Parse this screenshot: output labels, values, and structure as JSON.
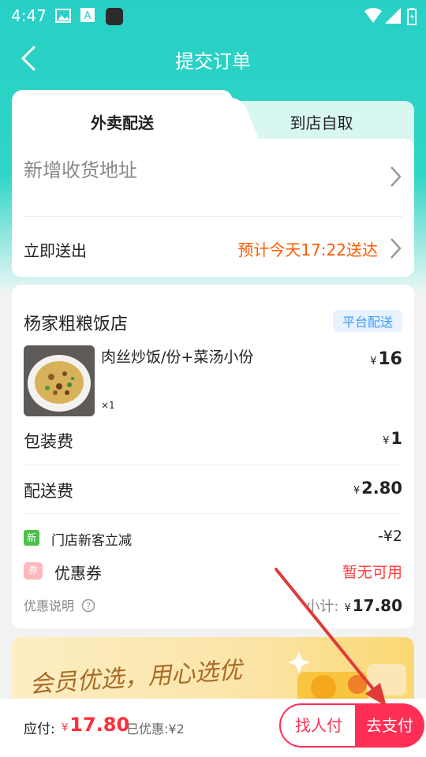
{
  "status_bar": {
    "time": "4:47"
  },
  "header": {
    "title": "提交订单"
  },
  "tabs": [
    {
      "label": "外卖配送"
    },
    {
      "label": "到店自取"
    }
  ],
  "address": {
    "placeholder": "新增收货地址"
  },
  "delivery": {
    "label": "立即送出",
    "eta": "预计今天17:22送达"
  },
  "store": {
    "name": "杨家粗粮饭店",
    "badge": "平台配送"
  },
  "item": {
    "name": "肉丝炒饭/份+菜汤小份",
    "qty": "×1",
    "currency": "¥",
    "price": "16"
  },
  "fees": [
    {
      "label": "包装费",
      "currency": "¥",
      "value": "1"
    },
    {
      "label": "配送费",
      "currency": "¥",
      "value": "2.80"
    }
  ],
  "promos": [
    {
      "badge": "新",
      "label": "门店新客立减",
      "value": "-¥2",
      "color": "#4cc04a"
    },
    {
      "badge": "券",
      "label": "优惠券",
      "value": "暂无可用",
      "color": "#ffb0b5"
    }
  ],
  "summary": {
    "note": "优惠说明",
    "subtotal_label": "小计:",
    "currency": "¥",
    "subtotal": "17.80"
  },
  "banner": {
    "text": "会员优选，用心选优"
  },
  "bottom": {
    "pay_label": "应付:",
    "currency": "¥",
    "pay_amount": "17.80",
    "discount": "已优惠:¥2",
    "friend_button": "找人付",
    "pay_button": "去支付"
  },
  "colors": {
    "accent": "#2fd6c6",
    "price": "#ff2e38",
    "eta": "#ff5a00",
    "button": "#ff2e54",
    "annotation_arrow": "#e03a3a"
  }
}
